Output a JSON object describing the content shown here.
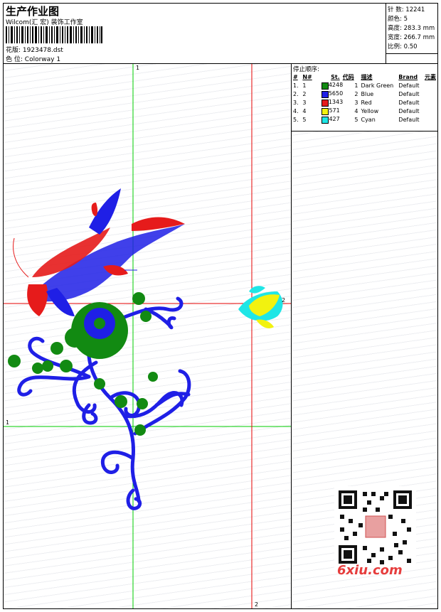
{
  "header": {
    "title": "生产作业图",
    "company": "Wilcom(汇 宏) 装饰工作室",
    "design_label": "花版:",
    "design_file": "1923478.dst",
    "colorway_label": "色 位:",
    "colorway": "Colorway 1"
  },
  "stats": {
    "stitches_label": "针 数:",
    "stitches": "12241",
    "colors_label": "颜色:",
    "colors": "5",
    "height_label": "高度:",
    "height": "283.3 mm",
    "width_label": "宽度:",
    "width": "266.7 mm",
    "scale_label": "比例:",
    "scale": "0.50"
  },
  "sequence": {
    "title": "停止顺序:",
    "columns": [
      "#",
      "N#",
      "St.",
      "代码",
      "描述",
      "Brand",
      "元素"
    ],
    "rows": [
      {
        "n": "1.",
        "stop": "1",
        "stitches": "4248",
        "code": "1",
        "desc": "Dark Green",
        "brand": "Default",
        "color": "#128a12"
      },
      {
        "n": "2.",
        "stop": "2",
        "stitches": "5650",
        "code": "2",
        "desc": "Blue",
        "brand": "Default",
        "color": "#1f1fe6"
      },
      {
        "n": "3.",
        "stop": "3",
        "stitches": "1343",
        "code": "3",
        "desc": "Red",
        "brand": "Default",
        "color": "#e61b1b"
      },
      {
        "n": "4.",
        "stop": "4",
        "stitches": "571",
        "code": "4",
        "desc": "Yellow",
        "brand": "Default",
        "color": "#f2f20f"
      },
      {
        "n": "5.",
        "stop": "5",
        "stitches": "427",
        "code": "5",
        "desc": "Cyan",
        "brand": "Default",
        "color": "#1fe6e6"
      }
    ]
  },
  "guides": {
    "label_1": "1",
    "label_2": "2",
    "green": "#00cc00",
    "red": "#e60000"
  },
  "watermark": {
    "brand": "6xiu.com",
    "icon": "qr-code-icon"
  }
}
